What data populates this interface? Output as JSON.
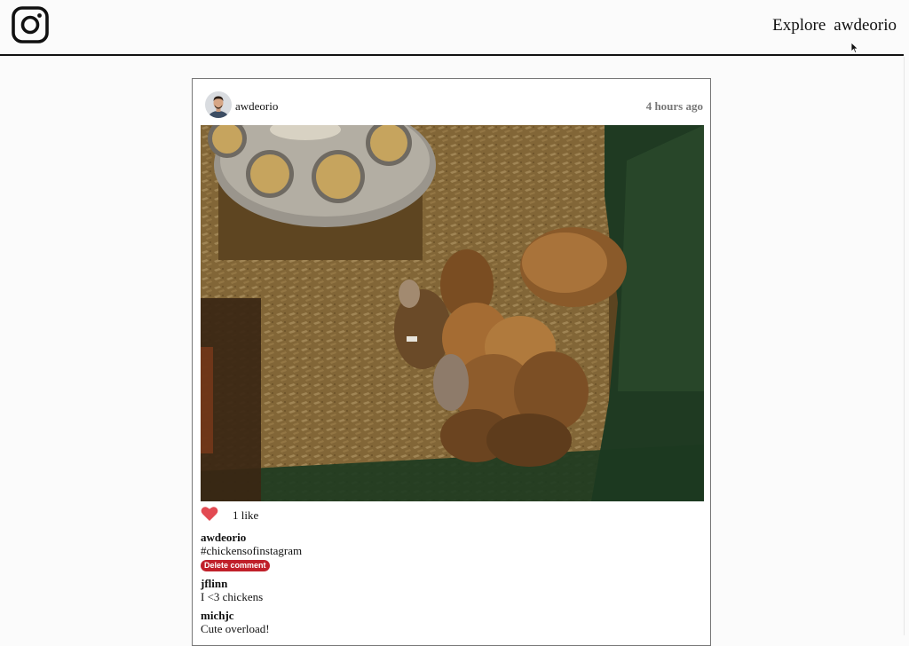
{
  "header": {
    "logo_icon": "instagram-icon",
    "nav": {
      "explore_label": "Explore",
      "user_label": "awdeorio"
    }
  },
  "post": {
    "owner": "awdeorio",
    "timestamp": "4 hours ago",
    "image_subject": "baby chicks in a brooder",
    "like_count_text": "1 like",
    "liked": true,
    "heart_color": "#e24a52",
    "comments": [
      {
        "author": "awdeorio",
        "text": "#chickensofinstagram",
        "delete_label": "Delete comment"
      },
      {
        "author": "jflinn",
        "text": "I <3 chickens"
      },
      {
        "author": "michjc",
        "text": "Cute overload!"
      }
    ]
  },
  "colors": {
    "delete_button": "#c0202a",
    "timestamp": "#777777"
  }
}
